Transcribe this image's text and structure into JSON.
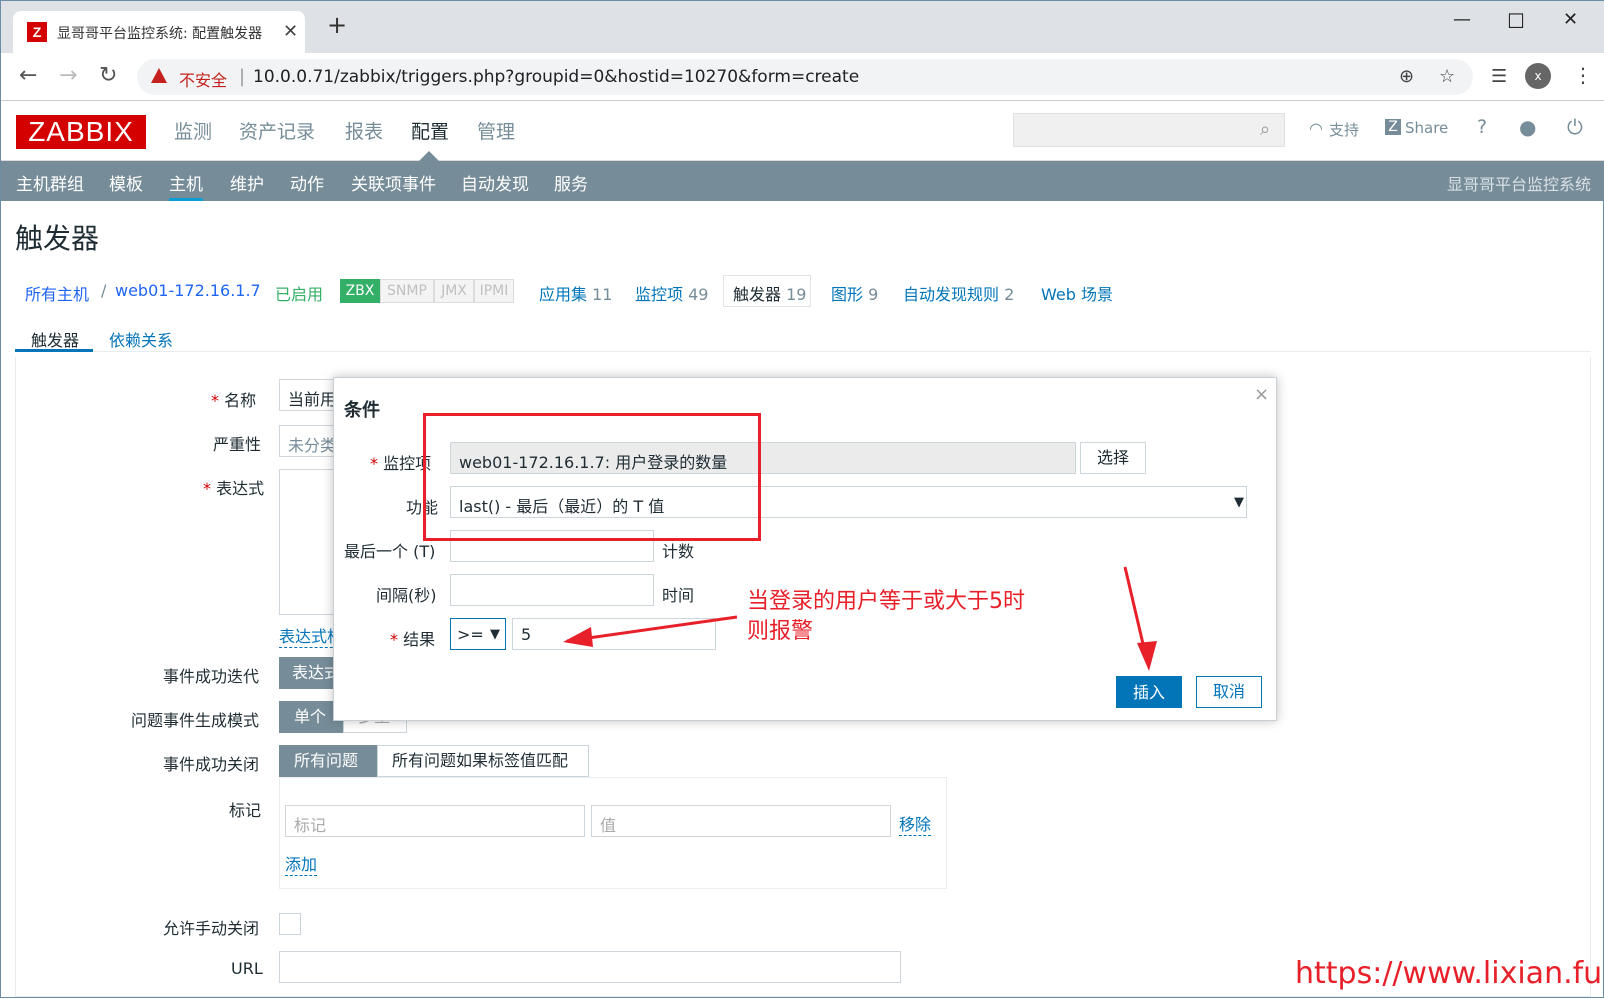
{
  "browser": {
    "tab_title": "显哥哥平台监控系统: 配置触发器",
    "tab_icon_letter": "Z",
    "insecure_label": "不安全",
    "url": "10.0.0.71/zabbix/triggers.php?groupid=0&hostid=10270&form=create",
    "profile_letter": "x"
  },
  "header": {
    "logo": "ZABBIX",
    "menu": [
      "监测",
      "资产记录",
      "报表",
      "配置",
      "管理"
    ],
    "support": "支持",
    "share": "Share",
    "help": "?"
  },
  "submenu": {
    "items": [
      "主机群组",
      "模板",
      "主机",
      "维护",
      "动作",
      "关联项事件",
      "自动发现",
      "服务"
    ],
    "system_name": "显哥哥平台监控系统"
  },
  "page": {
    "title": "触发器",
    "breadcrumb": {
      "all_hosts": "所有主机",
      "sep": "/",
      "host": "web01-172.16.1.7",
      "enabled": "已启用",
      "badges": [
        "ZBX",
        "SNMP",
        "JMX",
        "IPMI"
      ],
      "apps": "应用集",
      "apps_count": "11",
      "items": "监控项",
      "items_count": "49",
      "triggers": "触发器",
      "triggers_count": "19",
      "graphs": "图形",
      "graphs_count": "9",
      "discovery": "自动发现规则",
      "discovery_count": "2",
      "web": "Web 场景"
    },
    "tabs": [
      "触发器",
      "依赖关系"
    ]
  },
  "form": {
    "name_label": "名称",
    "name_value": "当前用",
    "severity_label": "严重性",
    "severity_value": "未分类",
    "expression_label": "表达式",
    "expression_link": "表达式构",
    "ok_event_label": "事件成功迭代",
    "ok_event_value": "表达式",
    "mode_label": "问题事件生成模式",
    "mode_single": "单个",
    "mode_multiple": "多重",
    "close_label": "事件成功关闭",
    "close_all": "所有问题",
    "close_tag": "所有问题如果标签值匹配",
    "tags_label": "标记",
    "tag_placeholder": "标记",
    "value_placeholder": "值",
    "remove": "移除",
    "add": "添加",
    "manual_close_label": "允许手动关闭",
    "url_label": "URL",
    "required_mark": "*"
  },
  "dialog": {
    "title": "条件",
    "close": "×",
    "item_label": "监控项",
    "item_value": "web01-172.16.1.7: 用户登录的数量",
    "select": "选择",
    "function_label": "功能",
    "function_value": "last() - 最后（最近）的 T 值",
    "last_label": "最后一个 (T)",
    "last_unit": "计数",
    "interval_label": "间隔(秒)",
    "interval_unit": "时间",
    "result_label": "结果",
    "operator": ">=",
    "result_value": "5",
    "insert": "插入",
    "cancel": "取消"
  },
  "annotation": {
    "line1": "当登录的用户等于或大于5时",
    "line2": "则报警",
    "watermark": "https://www.lixian.fun"
  }
}
